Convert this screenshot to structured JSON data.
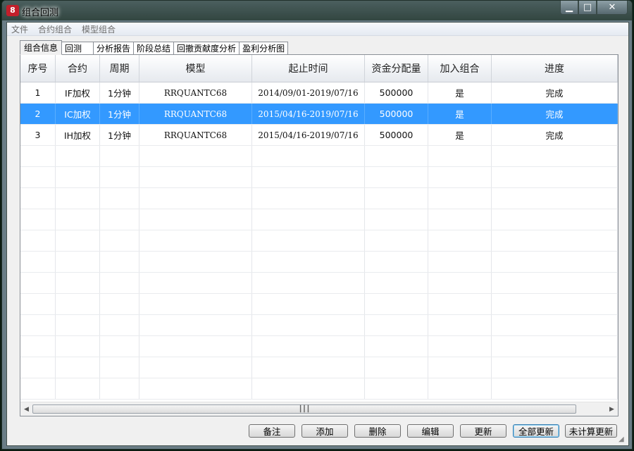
{
  "window": {
    "title": "组合回测",
    "icon_text": "8"
  },
  "menu": [
    "文件",
    "合约组合",
    "模型组合"
  ],
  "tabs": [
    "组合信息",
    "回测",
    "分析报告",
    "阶段总结",
    "回撤贡献度分析",
    "盈利分析图"
  ],
  "table": {
    "headers": [
      "序号",
      "合约",
      "周期",
      "模型",
      "起止时间",
      "资金分配量",
      "加入组合",
      "进度"
    ],
    "rows": [
      [
        "1",
        "IF加权",
        "1分钟",
        "RRQUANTC68",
        "2014/09/01-2019/07/16",
        "500000",
        "是",
        "完成"
      ],
      [
        "2",
        "IC加权",
        "1分钟",
        "RRQUANTC68",
        "2015/04/16-2019/07/16",
        "500000",
        "是",
        "完成"
      ],
      [
        "3",
        "IH加权",
        "1分钟",
        "RRQUANTC68",
        "2015/04/16-2019/07/16",
        "500000",
        "是",
        "完成"
      ]
    ],
    "selected_row": 2
  },
  "buttons": {
    "note": "备注",
    "add": "添加",
    "delete": "删除",
    "edit": "编辑",
    "update": "更新",
    "update_all": "全部更新",
    "update_uncomputed": "未计算更新"
  },
  "colors": {
    "selection": "#3399ff"
  }
}
